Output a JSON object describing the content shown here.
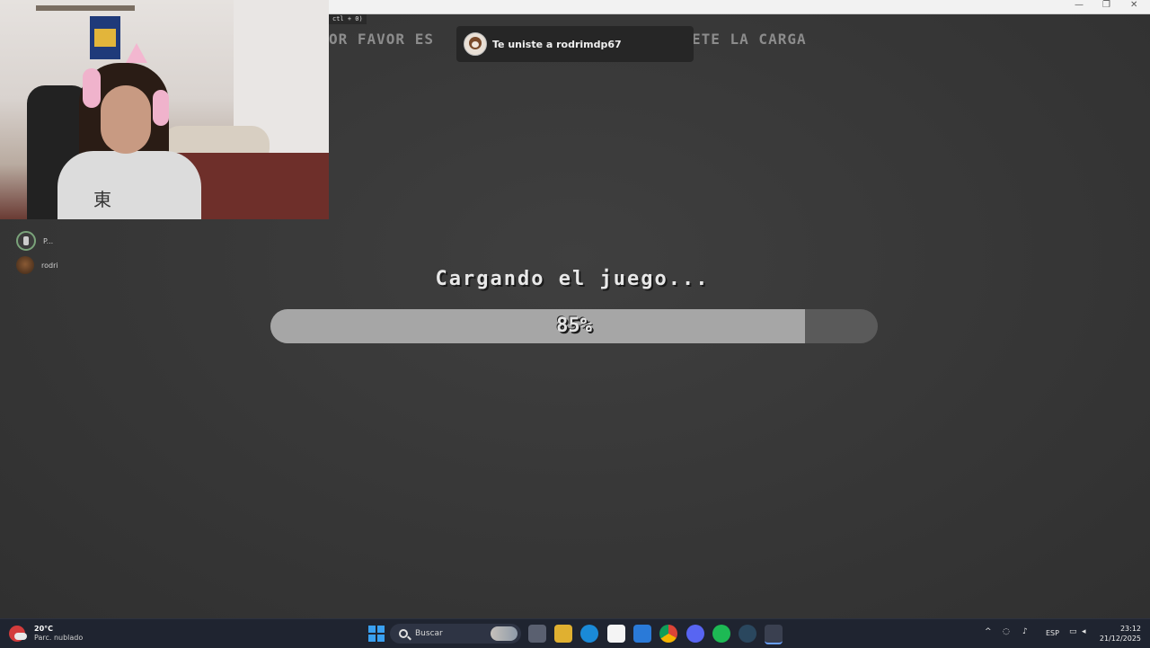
{
  "window": {
    "minimize": "—",
    "restore": "❐",
    "close": "✕",
    "tag": "ctl + 0)"
  },
  "banner": {
    "left": "OR FAVOR ES",
    "right": "ETE LA CARGA"
  },
  "toast": {
    "text": "Te uniste a rodrimdp67",
    "avatar": "roblox-avatar-icon"
  },
  "webcam": {
    "shirt_text": "東"
  },
  "participants": [
    {
      "name": "P...",
      "icon": "mic-avatar-icon"
    },
    {
      "name": "rodri",
      "icon": "user-avatar-icon"
    }
  ],
  "loading": {
    "title": "Cargando el juego...",
    "progress_label": "85%",
    "progress_value": 0.88
  },
  "colors": {
    "background": "#3a3a3a",
    "progress_fill": "#a6a6a6",
    "progress_track": "#5a5a5a",
    "taskbar": "#1f2430"
  },
  "taskbar": {
    "weather_temp": "20°C",
    "weather_cond": "Parc. nublado",
    "search_placeholder": "Buscar",
    "apps": [
      "start-icon",
      "task-view-icon",
      "file-explorer-icon",
      "edge-icon",
      "store-icon",
      "outlook-icon",
      "chrome-icon",
      "discord-icon",
      "spotify-icon",
      "steam-icon",
      "roblox-icon"
    ],
    "language": "ESP",
    "time": "23:12",
    "date": "21/12/2025"
  }
}
